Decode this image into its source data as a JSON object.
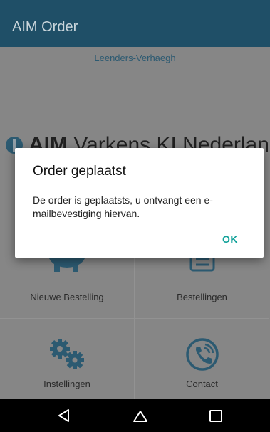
{
  "appbar": {
    "title": "AIM Order"
  },
  "header": {
    "company": "Leenders-Verhaegh"
  },
  "brand": {
    "bold": "AIM",
    "rest": " Varkens KI Nederland"
  },
  "menu": {
    "new_order": "Nieuwe Bestelling",
    "orders": "Bestellingen",
    "settings": "Instellingen",
    "contact": "Contact"
  },
  "dialog": {
    "title": "Order geplaatst",
    "message": "De order is geplaatsts, u ontvangt een e-mailbevestiging hiervan.",
    "ok": "OK"
  },
  "colors": {
    "appbar": "#1f4f67",
    "accent": "#12a29a",
    "icon": "#2f5f78"
  },
  "icons": {
    "new_order": "piggy-bank-icon",
    "orders": "list-icon",
    "settings": "gears-icon",
    "contact": "phone-icon",
    "back": "back-icon",
    "home": "home-icon",
    "recents": "recents-icon"
  }
}
